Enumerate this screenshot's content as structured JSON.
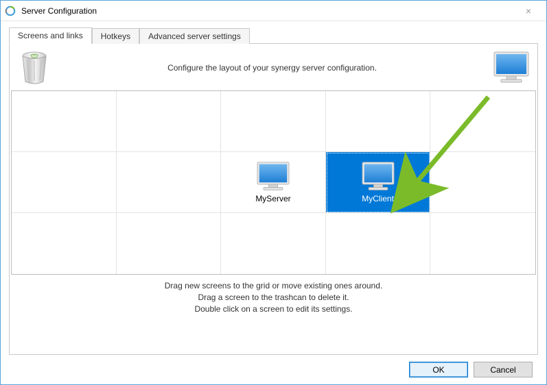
{
  "window": {
    "title": "Server Configuration",
    "close_glyph": "×"
  },
  "tabs": [
    {
      "label": "Screens and links",
      "active": true
    },
    {
      "label": "Hotkeys",
      "active": false
    },
    {
      "label": "Advanced server settings",
      "active": false
    }
  ],
  "top": {
    "instruction": "Configure the layout of your synergy server configuration.",
    "trash_icon": "trash-icon",
    "new_screen_icon": "monitor-icon"
  },
  "grid": {
    "cols": 5,
    "rows": 3,
    "screens": [
      {
        "row": 1,
        "col": 2,
        "name": "MyServer",
        "selected": false
      },
      {
        "row": 1,
        "col": 3,
        "name": "MyClient",
        "selected": true
      }
    ]
  },
  "hints": [
    "Drag new screens to the grid or move existing ones around.",
    "Drag a screen to the trashcan to delete it.",
    "Double click on a screen to edit its settings."
  ],
  "buttons": {
    "ok": "OK",
    "cancel": "Cancel"
  },
  "colors": {
    "accent": "#0078d7",
    "arrow": "#7bbb2a"
  }
}
